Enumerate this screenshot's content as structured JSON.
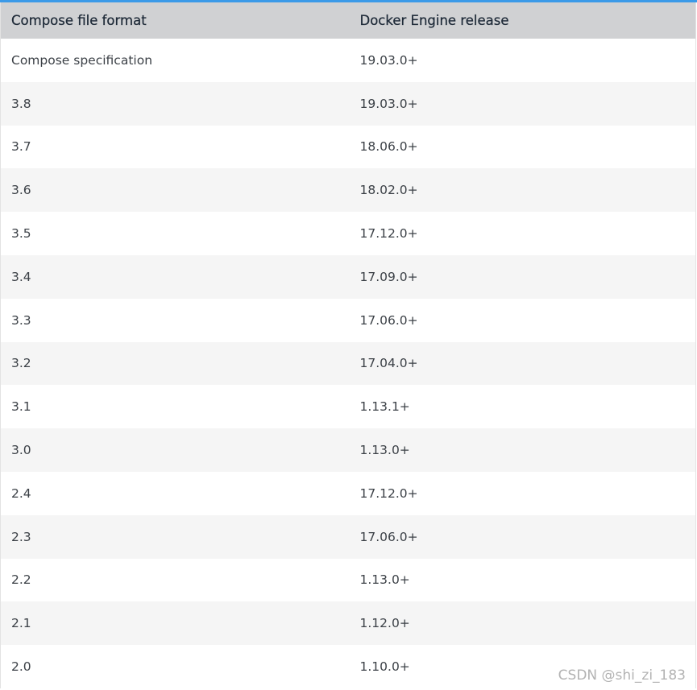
{
  "table": {
    "headers": [
      "Compose file format",
      "Docker Engine release"
    ],
    "rows": [
      [
        "Compose specification",
        "19.03.0+"
      ],
      [
        "3.8",
        "19.03.0+"
      ],
      [
        "3.7",
        "18.06.0+"
      ],
      [
        "3.6",
        "18.02.0+"
      ],
      [
        "3.5",
        "17.12.0+"
      ],
      [
        "3.4",
        "17.09.0+"
      ],
      [
        "3.3",
        "17.06.0+"
      ],
      [
        "3.2",
        "17.04.0+"
      ],
      [
        "3.1",
        "1.13.1+"
      ],
      [
        "3.0",
        "1.13.0+"
      ],
      [
        "2.4",
        "17.12.0+"
      ],
      [
        "2.3",
        "17.06.0+"
      ],
      [
        "2.2",
        "1.13.0+"
      ],
      [
        "2.1",
        "1.12.0+"
      ],
      [
        "2.0",
        "1.10.0+"
      ]
    ]
  },
  "watermark": "CSDN @shi_zi_183",
  "colors": {
    "accent": "#3b9ae8",
    "header_bg": "#d0d1d3",
    "row_alt_bg": "#f5f5f5"
  }
}
